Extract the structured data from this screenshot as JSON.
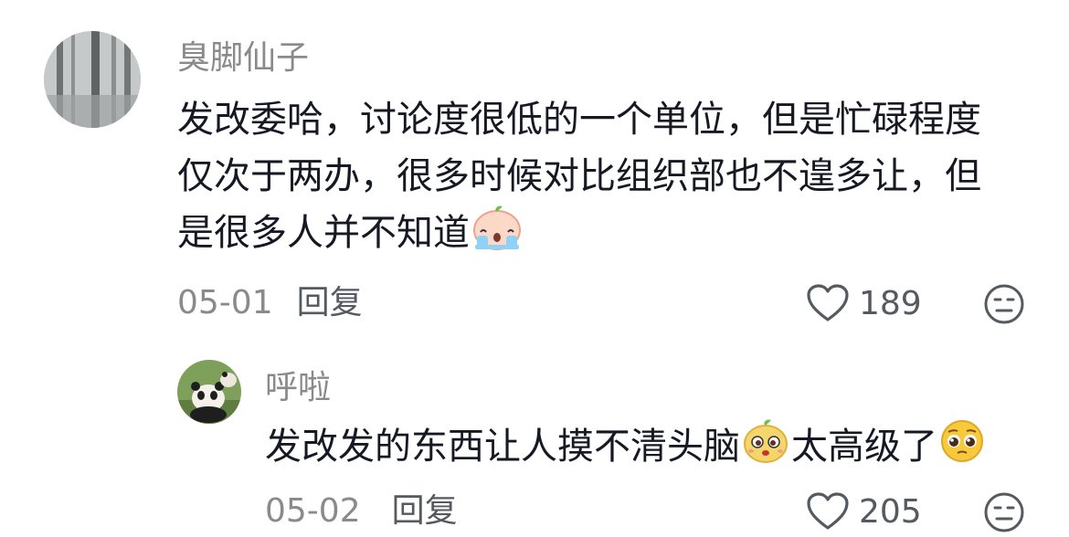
{
  "comments": [
    {
      "username": "臭脚仙子",
      "avatar": "misty-forest-avatar",
      "lines": [
        "发改委哈，讨论度很低的一个单位，但是忙碌程度",
        "仅次于两办，很多时候对比组织部也不遑多让，但",
        "是很多人并不知道"
      ],
      "trailing_emoji": "crying-bun-emoji",
      "date": "05-01",
      "reply_label": "回复",
      "like_count": "189",
      "like_icon": "heart-outline-icon",
      "dislike_icon": "meh-face-icon"
    }
  ],
  "replies": [
    {
      "username": "呼啦",
      "avatar": "panda-avatar",
      "text_part1": "发改发的东西让人摸不清头脑",
      "inline_emoji": "puzzled-bun-emoji",
      "text_part2": "太高级了",
      "trailing_emoji": "pleading-face-emoji",
      "date": "05-02",
      "reply_label": "回复",
      "like_count": "205",
      "like_icon": "heart-outline-icon",
      "dislike_icon": "meh-face-icon"
    }
  ],
  "colors": {
    "username": "#8a8a8a",
    "content": "#161823",
    "meta": "#555a60"
  }
}
